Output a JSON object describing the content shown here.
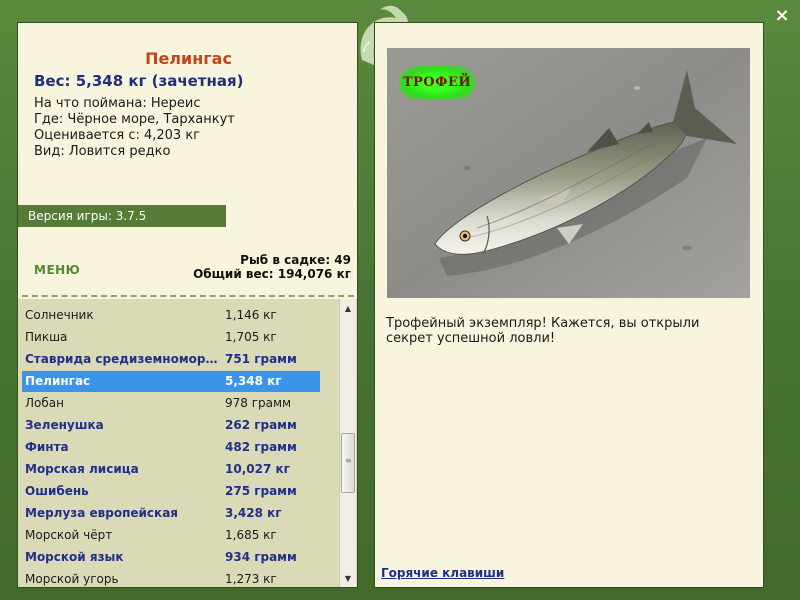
{
  "window": {
    "close_glyph": "×"
  },
  "fish": {
    "name": "Пелингас",
    "weight_line": "Вес: 5,348 кг (зачетная)",
    "info": [
      "На что поймана: Нереис",
      "Где: Чёрное море, Тарханкут",
      "Оценивается с: 4,203 кг",
      "Вид: Ловится редко"
    ]
  },
  "version": "Версия игры: 3.7.5",
  "menu_label": "МЕНЮ",
  "stats": {
    "keepnet": "Рыб в садке: 49",
    "total_weight": "Общий вес: 194,076 кг"
  },
  "catch_list": [
    {
      "name": "Солнечник",
      "weight": "1,146 кг",
      "bold": false
    },
    {
      "name": "Пикша",
      "weight": "1,705 кг",
      "bold": false
    },
    {
      "name": "Ставрида средиземноморская",
      "weight": "751 грамм",
      "bold": true
    },
    {
      "name": "Пелингас",
      "weight": "5,348 кг",
      "bold": true,
      "selected": true
    },
    {
      "name": "Лобан",
      "weight": "978 грамм",
      "bold": false
    },
    {
      "name": "Зеленушка",
      "weight": "262 грамм",
      "bold": true
    },
    {
      "name": "Финта",
      "weight": "482 грамм",
      "bold": true
    },
    {
      "name": "Морская лисица",
      "weight": "10,027 кг",
      "bold": true
    },
    {
      "name": "Ошибень",
      "weight": "275 грамм",
      "bold": true
    },
    {
      "name": "Мерлуза европейская",
      "weight": "3,428 кг",
      "bold": true
    },
    {
      "name": "Морской чёрт",
      "weight": "1,685 кг",
      "bold": false
    },
    {
      "name": "Морской язык",
      "weight": "934 грамм",
      "bold": true
    },
    {
      "name": "Морской угорь",
      "weight": "1,273 кг",
      "bold": false
    }
  ],
  "trophy_badge": "ТРОФЕЙ",
  "description": "Трофейный экземпляр! Кажется, вы открыли секрет успешной ловли!",
  "hotkeys_link": "Горячие клавиши",
  "colors": {
    "frame": "#4f7a37",
    "panel": "#f8f4de",
    "title": "#c2461a",
    "weight": "#1f2f7a",
    "selected_row": "#3c93ea",
    "list_bg": "#dbdab7",
    "trophy_glow": "#3cff20"
  },
  "icons": [
    "close-icon",
    "dolphin-logo-icon",
    "scroll-up-arrow-icon",
    "scroll-down-arrow-icon",
    "scroll-grip-icon"
  ]
}
